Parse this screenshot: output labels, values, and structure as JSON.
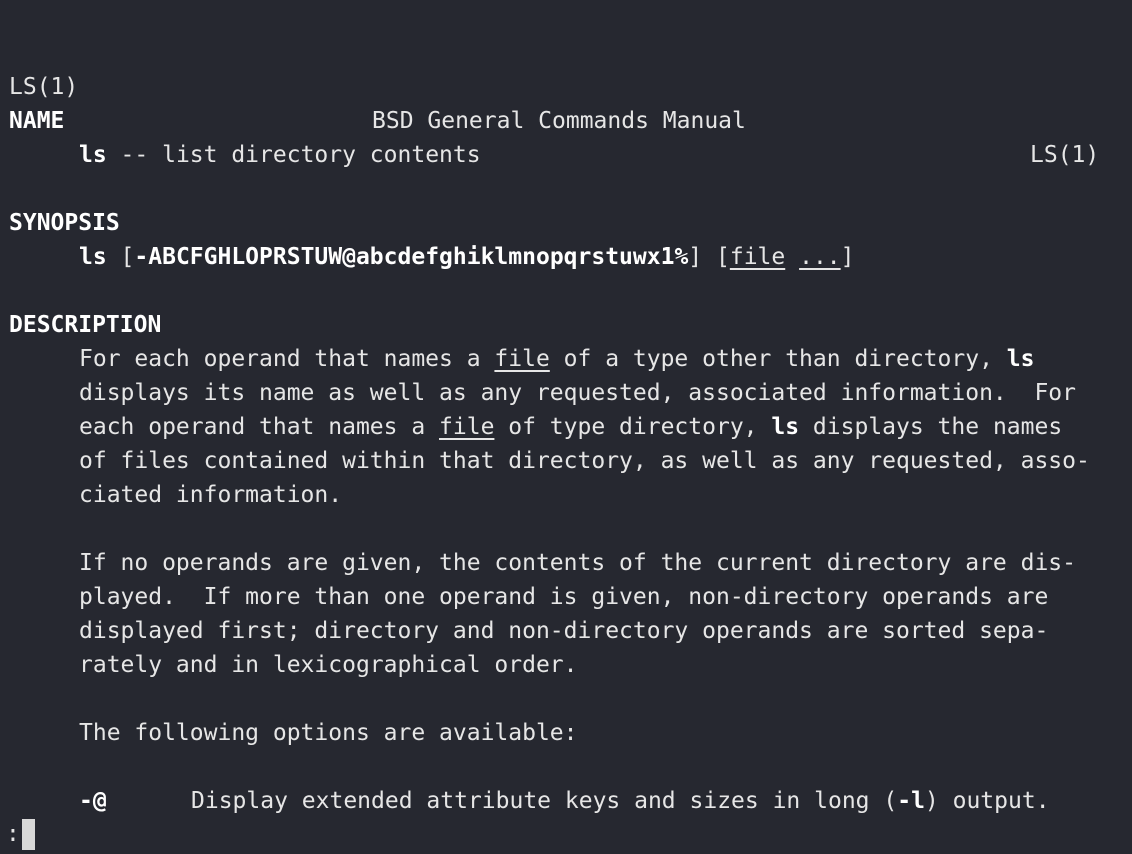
{
  "header": {
    "left": "LS(1)",
    "center": "BSD General Commands Manual",
    "right": "LS(1)"
  },
  "name": {
    "heading": "NAME",
    "cmd": "ls",
    "desc": " -- list directory contents"
  },
  "synopsis": {
    "heading": "SYNOPSIS",
    "cmd": "ls",
    "lbracket": " [",
    "flags": "-ABCFGHLOPRSTUW@abcdefghiklmnopqrstuwx1%",
    "mid": "] [",
    "file": "file",
    "space": " ",
    "ellipsis": "...",
    "rbracket": "]"
  },
  "description": {
    "heading": "DESCRIPTION",
    "p1": {
      "l1a": "For each operand that names a ",
      "l1file": "file",
      "l1b": " of a type other than directory, ",
      "l1ls": "ls",
      "l2": "displays its name as well as any requested, associated information.  For",
      "l3a": "each operand that names a ",
      "l3file": "file",
      "l3b": " of type directory, ",
      "l3ls": "ls",
      "l3c": " displays the names",
      "l4": "of files contained within that directory, as well as any requested, asso-",
      "l5": "ciated information."
    },
    "p2": {
      "l1": "If no operands are given, the contents of the current directory are dis-",
      "l2": "played.  If more than one operand is given, non-directory operands are",
      "l3": "displayed first; directory and non-directory operands are sorted sepa-",
      "l4": "rately and in lexicographical order."
    },
    "p3": "The following options are available:",
    "option": {
      "flag": "-@",
      "text_a": "Display extended attribute keys and sizes in long (",
      "text_flag": "-l",
      "text_b": ") output."
    }
  },
  "prompt": ":"
}
